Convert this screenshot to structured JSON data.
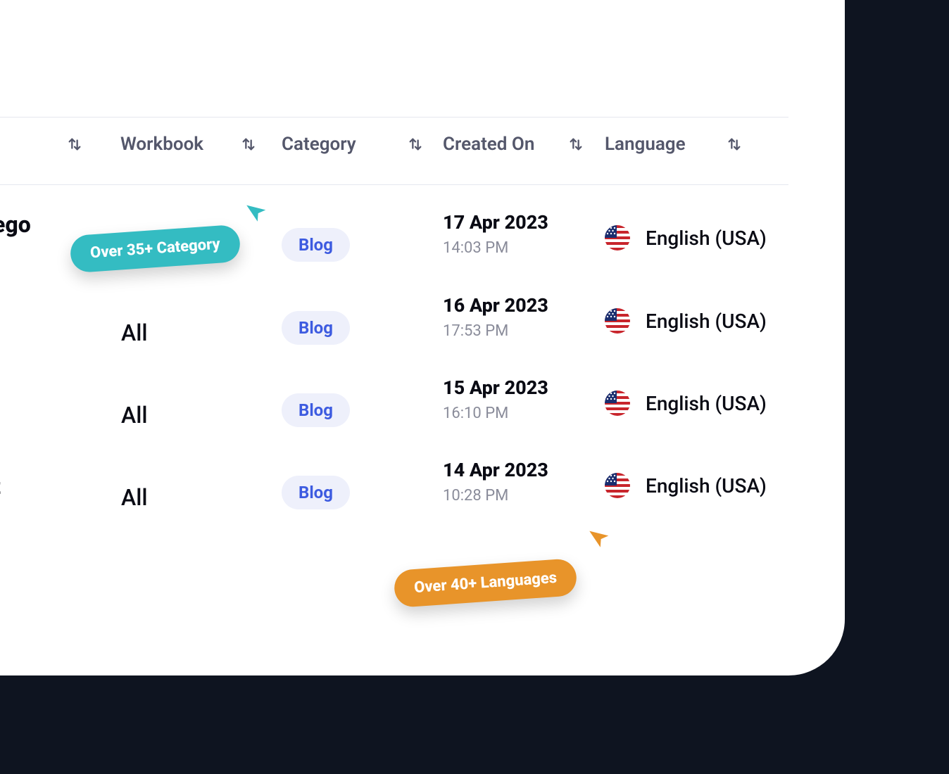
{
  "table": {
    "headers": {
      "workbook": "Workbook",
      "category": "Category",
      "created_on": "Created On",
      "language": "Language"
    },
    "rows": [
      {
        "partial_left": "ego",
        "workbook": "",
        "category": "Blog",
        "created_date": "17 Apr 2023",
        "created_time": "14:03 PM",
        "language": "English (USA)",
        "flag": "us"
      },
      {
        "partial_left": "",
        "workbook": "All",
        "category": "Blog",
        "created_date": "16 Apr 2023",
        "created_time": "17:53 PM",
        "language": "English (USA)",
        "flag": "us"
      },
      {
        "partial_left": "",
        "workbook": "All",
        "category": "Blog",
        "created_date": "15 Apr 2023",
        "created_time": "16:10 PM",
        "language": "English (USA)",
        "flag": "us"
      },
      {
        "partial_left": "t",
        "workbook": "All",
        "category": "Blog",
        "created_date": "14 Apr 2023",
        "created_time": "10:28 PM",
        "language": "English (USA)",
        "flag": "us"
      }
    ]
  },
  "callouts": {
    "category": "Over 35+ Category",
    "languages": "Over 40+ Languages"
  },
  "colors": {
    "teal": "#34bcc2",
    "orange": "#e8942a",
    "badge_bg": "#eef0fb",
    "badge_text": "#3d5be0"
  }
}
